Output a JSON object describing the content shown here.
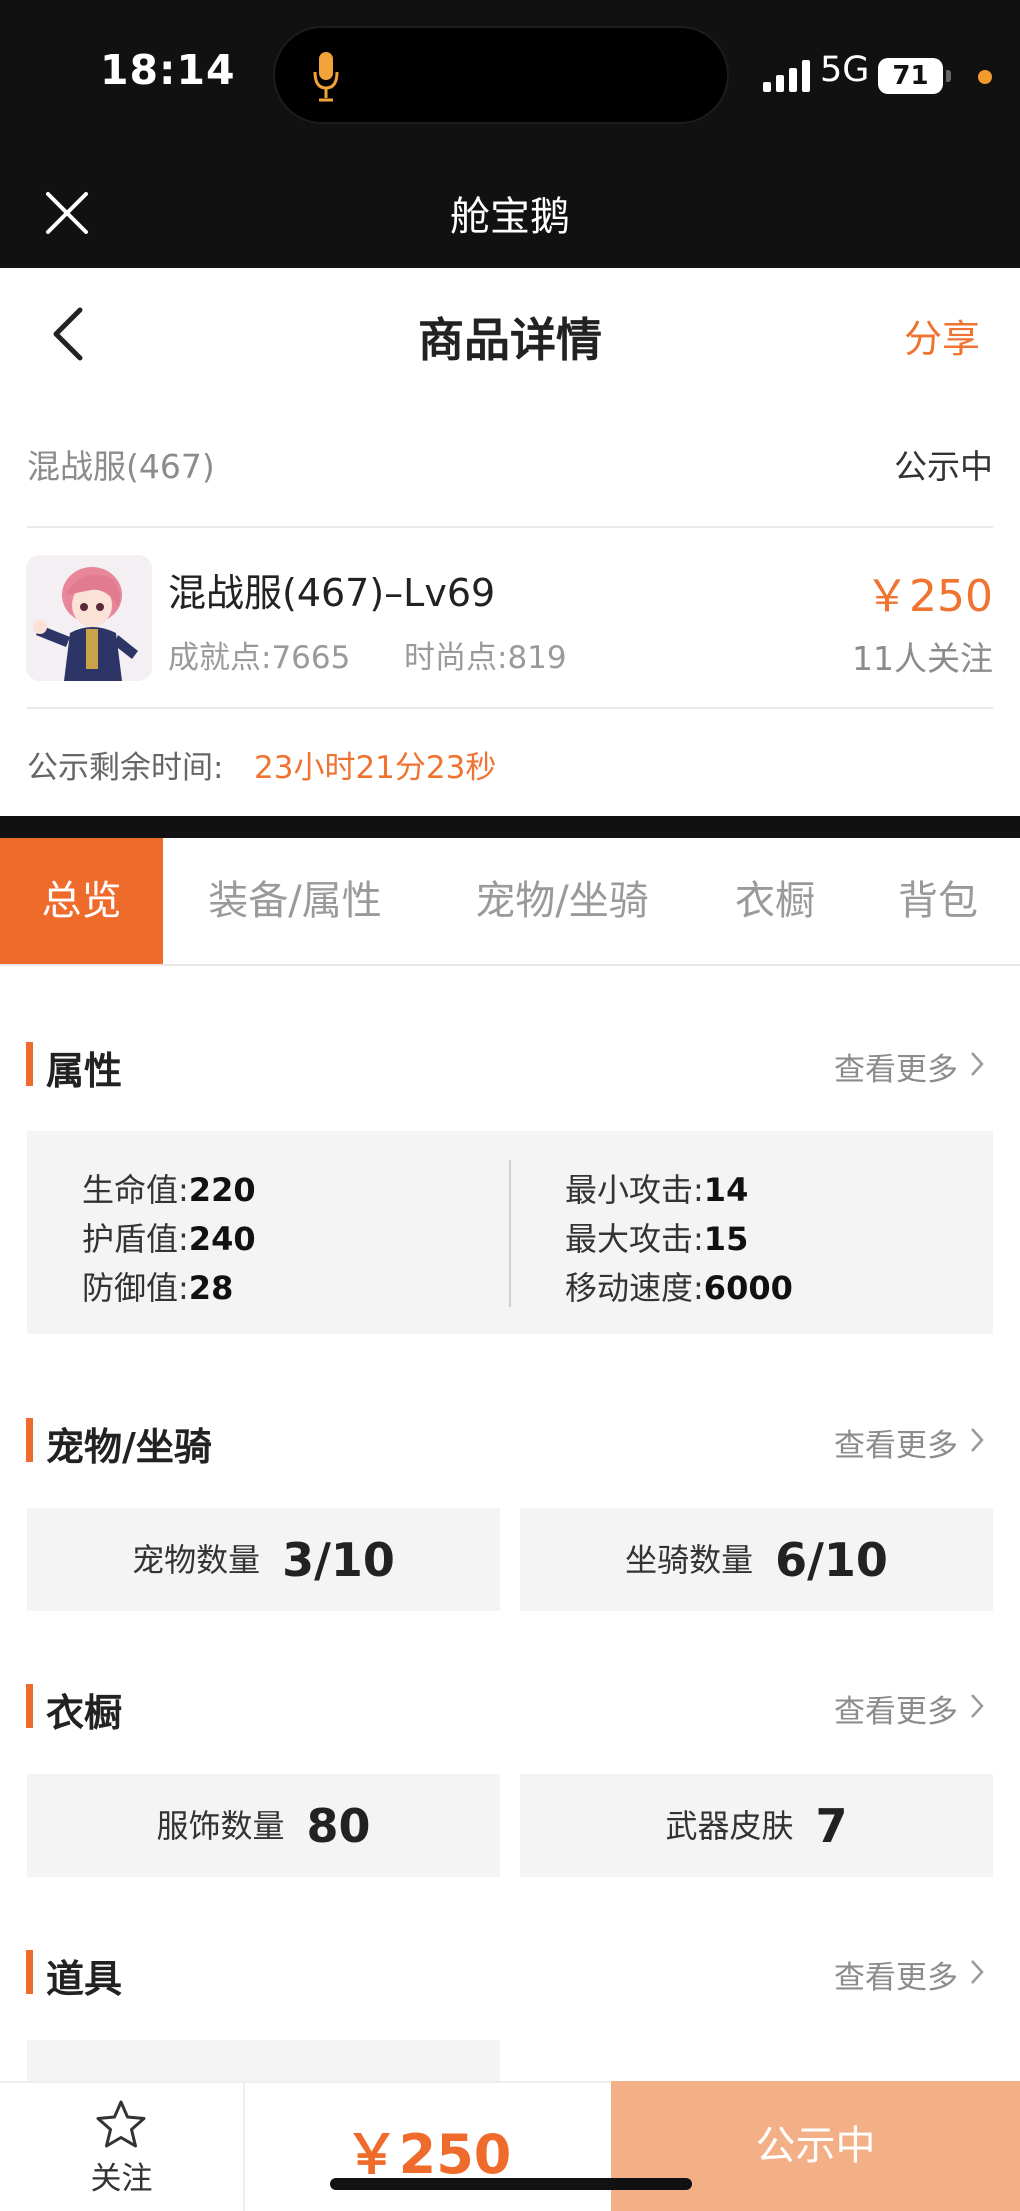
{
  "status_bar": {
    "time": "18:14",
    "network": "5G",
    "battery": "71"
  },
  "miniapp": {
    "title": "舱宝鹅"
  },
  "nav": {
    "title": "商品详情",
    "share": "分享"
  },
  "product": {
    "server": "混战服(467)",
    "status": "公示中",
    "name": "混战服(467)–Lv69",
    "achievement": "成就点:7665",
    "fashion": "时尚点:819",
    "price": "￥250",
    "followers": "11人关注",
    "remain_label": "公示剩余时间:",
    "remain_value": "23小时21分23秒"
  },
  "tabs": [
    "总览",
    "装备/属性",
    "宠物/坐骑",
    "衣橱",
    "背包"
  ],
  "sections": {
    "attributes": {
      "title": "属性",
      "more": "查看更多",
      "left": [
        {
          "label": "生命值:",
          "value": "220"
        },
        {
          "label": "护盾值:",
          "value": "240"
        },
        {
          "label": "防御值:",
          "value": "28"
        }
      ],
      "right": [
        {
          "label": "最小攻击:",
          "value": "14"
        },
        {
          "label": "最大攻击:",
          "value": "15"
        },
        {
          "label": "移动速度:",
          "value": "6000"
        }
      ]
    },
    "pets": {
      "title": "宠物/坐骑",
      "more": "查看更多",
      "stats": [
        {
          "label": "宠物数量",
          "value": "3/10"
        },
        {
          "label": "坐骑数量",
          "value": "6/10"
        }
      ]
    },
    "wardrobe": {
      "title": "衣橱",
      "more": "查看更多",
      "stats": [
        {
          "label": "服饰数量",
          "value": "80"
        },
        {
          "label": "武器皮肤",
          "value": "7"
        }
      ]
    },
    "items": {
      "title": "道具",
      "more": "查看更多"
    }
  },
  "bottom": {
    "follow": "关注",
    "price": "￥250",
    "status": "公示中"
  },
  "colors": {
    "accent": "#ef6b2c",
    "status_button": "#f3b087",
    "header_bg": "#111111"
  }
}
